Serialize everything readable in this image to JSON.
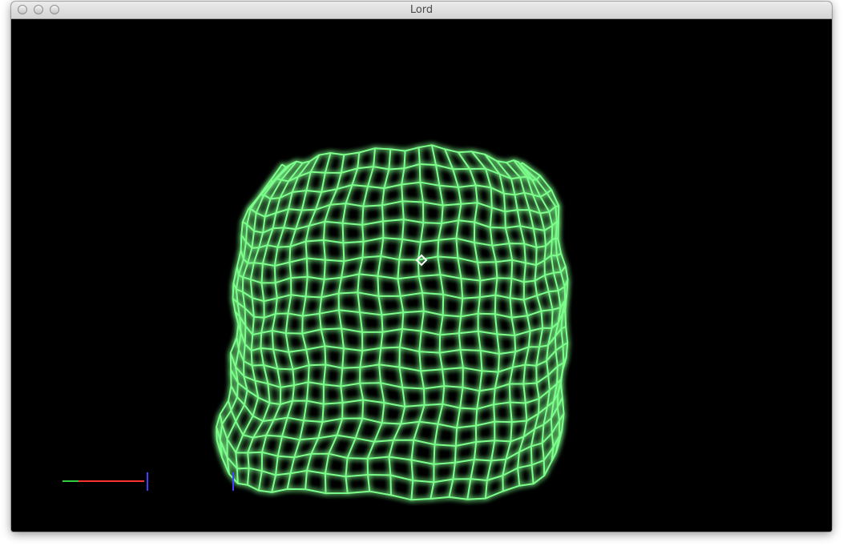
{
  "window": {
    "title": "Lord",
    "controls": [
      "close",
      "minimize",
      "zoom"
    ]
  },
  "scene": {
    "background": "#000000",
    "mesh_color": "#7dff8c",
    "glow_color": "#3dcf4d",
    "cursor_icon": "diamond-cursor-icon",
    "axis_colors": {
      "x": "#ff3030",
      "y": "#30d040",
      "z": "#4040ff"
    }
  }
}
